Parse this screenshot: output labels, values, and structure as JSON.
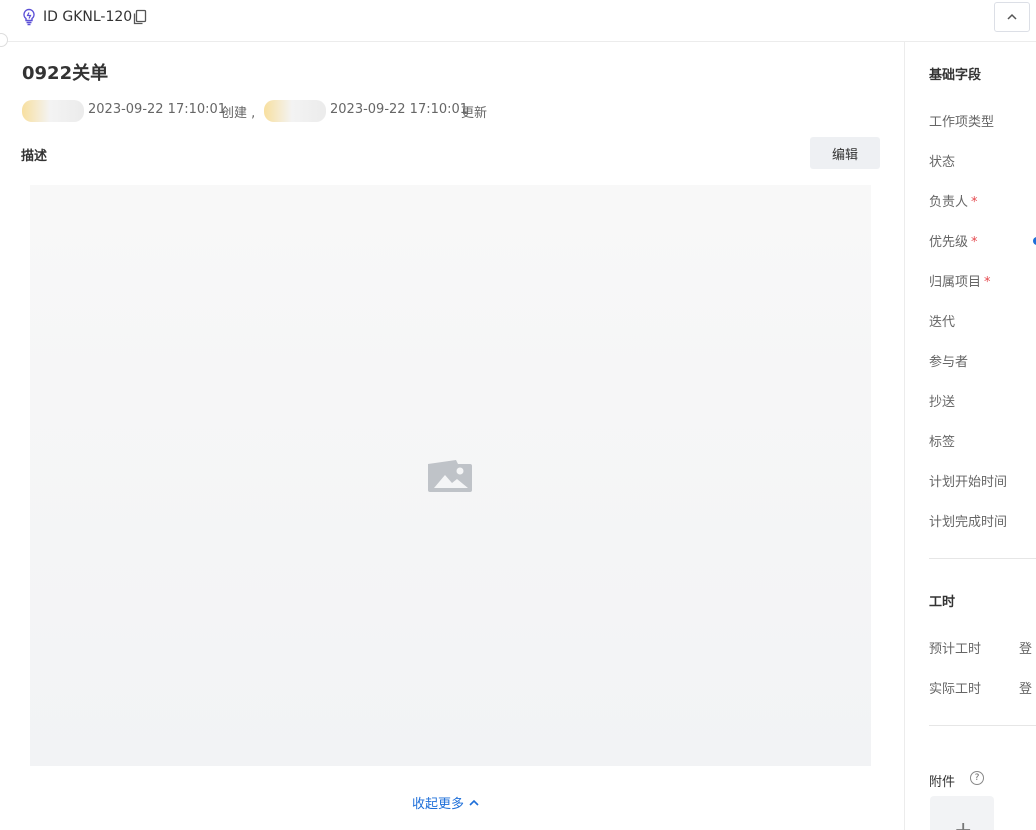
{
  "header": {
    "item_id": "ID GKNL-120",
    "icons": {
      "type": "bulb-icon",
      "copy": "copy-icon",
      "collapse": "chevron-up-icon"
    }
  },
  "main": {
    "title": "0922关单",
    "meta": {
      "created_at": "2023-09-22 17:10:01",
      "created_label": "创建 ,",
      "updated_at": "2023-09-22 17:10:01",
      "updated_label": "更新"
    },
    "description_label": "描述",
    "edit_button": "编辑",
    "collapse_more": "收起更多"
  },
  "sidebar": {
    "basic_title": "基础字段",
    "fields": [
      {
        "label": "工作项类型",
        "required": false
      },
      {
        "label": "状态",
        "required": false
      },
      {
        "label": "负责人",
        "required": true
      },
      {
        "label": "优先级",
        "required": true
      },
      {
        "label": "归属项目",
        "required": true
      },
      {
        "label": "迭代",
        "required": false
      },
      {
        "label": "参与者",
        "required": false
      },
      {
        "label": "抄送",
        "required": false
      },
      {
        "label": "标签",
        "required": false
      },
      {
        "label": "计划开始时间",
        "required": false
      },
      {
        "label": "计划完成时间",
        "required": false
      }
    ],
    "required_mark": "*",
    "worktime_title": "工时",
    "worktime": [
      {
        "label": "预计工时",
        "value": "登"
      },
      {
        "label": "实际工时",
        "value": "登"
      }
    ],
    "attachments_title": "附件",
    "help_symbol": "?",
    "upload_symbol": "+"
  },
  "colors": {
    "accent": "#1e6fd9",
    "required": "#e5484d",
    "icon_purple": "#5b4fd6"
  }
}
